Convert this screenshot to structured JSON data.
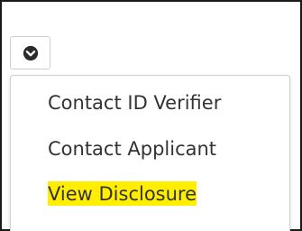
{
  "toggle": {
    "icon": "chevron-down-circle-icon"
  },
  "menu": {
    "items": [
      {
        "label": "Contact ID Verifier",
        "highlighted": false
      },
      {
        "label": "Contact Applicant",
        "highlighted": false
      },
      {
        "label": "View Disclosure",
        "highlighted": true
      }
    ],
    "highlight_color": "#ffee00"
  }
}
